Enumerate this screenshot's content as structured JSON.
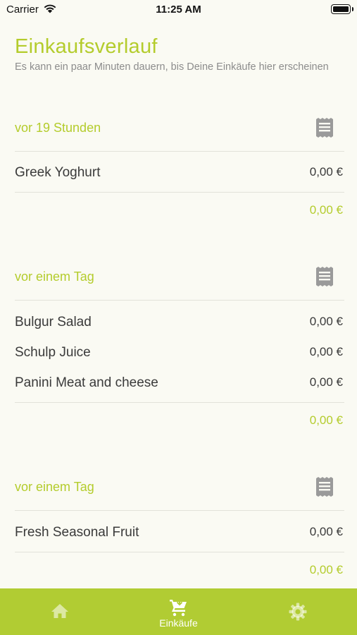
{
  "status_bar": {
    "carrier": "Carrier",
    "time": "11:25 AM"
  },
  "header": {
    "title": "Einkaufsverlauf",
    "subtitle": "Es kann ein paar Minuten dauern, bis Deine Einkäufe hier erscheinen"
  },
  "groups": [
    {
      "time": "vor 19 Stunden",
      "items": [
        {
          "name": "Greek Yoghurt",
          "price": "0,00 €"
        }
      ],
      "total": "0,00 €"
    },
    {
      "time": "vor einem Tag",
      "items": [
        {
          "name": "Bulgur Salad",
          "price": "0,00 €"
        },
        {
          "name": "Schulp Juice",
          "price": "0,00 €"
        },
        {
          "name": "Panini Meat and cheese",
          "price": "0,00 €"
        }
      ],
      "total": "0,00 €"
    },
    {
      "time": "vor einem Tag",
      "items": [
        {
          "name": "Fresh Seasonal Fruit",
          "price": "0,00 €"
        }
      ],
      "total": "0,00 €"
    }
  ],
  "tab_bar": {
    "tabs": [
      {
        "icon": "home-icon",
        "label": ""
      },
      {
        "icon": "cart-icon",
        "label": "Einkäufe",
        "active": true
      },
      {
        "icon": "gear-icon",
        "label": ""
      }
    ]
  },
  "colors": {
    "accent": "#b4cc2c",
    "tab_bar": "#b1cc33",
    "background": "#fafaf3",
    "text": "#3a3a3a",
    "subtle_text": "#8c8c8c",
    "icon_gray": "#9a9a9a"
  }
}
